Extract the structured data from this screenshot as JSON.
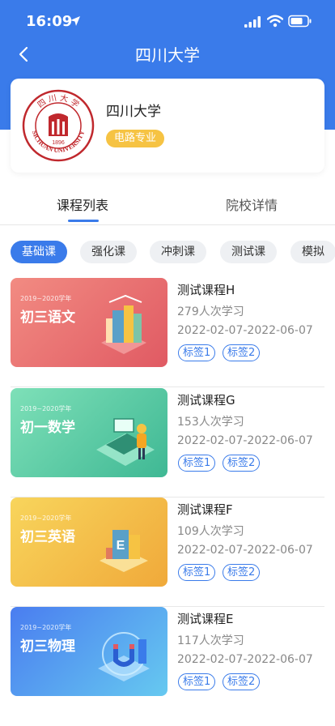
{
  "status_bar": {
    "time": "16:09"
  },
  "nav": {
    "title": "四川大学"
  },
  "school": {
    "name": "四川大学",
    "major": "电路专业",
    "logo_text": "SICHUAN UNIVERSITY",
    "logo_year": "1896"
  },
  "tabs": [
    {
      "label": "课程列表",
      "active": true
    },
    {
      "label": "院校详情",
      "active": false
    }
  ],
  "filters": [
    "基础课",
    "强化课",
    "冲刺课",
    "测试课",
    "模拟"
  ],
  "courses": [
    {
      "title": "测试课程H",
      "learners": "279人次学习",
      "dates": "2022-02-07-2022-06-07",
      "tags": [
        "标签1",
        "标签2"
      ],
      "thumb_year": "2019~2020学年",
      "thumb_title": "初三语文"
    },
    {
      "title": "测试课程G",
      "learners": "153人次学习",
      "dates": "2022-02-07-2022-06-07",
      "tags": [
        "标签1",
        "标签2"
      ],
      "thumb_year": "2019~2020学年",
      "thumb_title": "初一数学"
    },
    {
      "title": "测试课程F",
      "learners": "109人次学习",
      "dates": "2022-02-07-2022-06-07",
      "tags": [
        "标签1",
        "标签2"
      ],
      "thumb_year": "2019~2020学年",
      "thumb_title": "初三英语"
    },
    {
      "title": "测试课程E",
      "learners": "117人次学习",
      "dates": "2022-02-07-2022-06-07",
      "tags": [
        "标签1",
        "标签2"
      ],
      "thumb_year": "2019~2020学年",
      "thumb_title": "初三物理"
    }
  ],
  "colors": {
    "primary": "#3a7bea",
    "badge": "#f6c343",
    "logo_red": "#c0282d"
  }
}
